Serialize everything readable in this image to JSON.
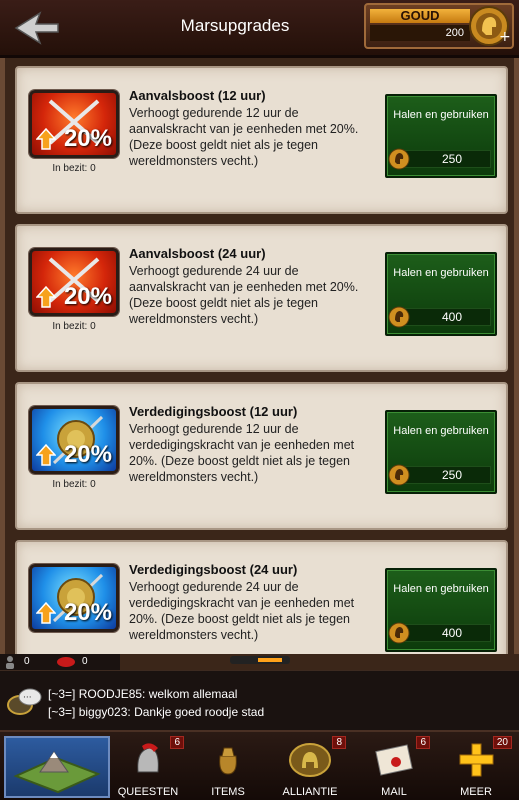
{
  "header": {
    "title": "Marsupgrades",
    "gold_label": "GOUD",
    "gold_value": "200"
  },
  "cards": [
    {
      "title": "Aanvalsboost (12 uur)",
      "desc": "Verhoogt gedurende 12 uur de aanvalskracht van je eenheden met 20%. (Deze boost geldt niet als je tegen wereldmonsters vecht.)",
      "pct": "20%",
      "in_bezit": "In bezit: 0",
      "button": "Halen en gebruiken",
      "price": "250",
      "kind": "attack"
    },
    {
      "title": "Aanvalsboost (24 uur)",
      "desc": "Verhoogt gedurende 24 uur de aanvalskracht van je eenheden met 20%.(Deze boost geldt niet als je tegen wereldmonsters vecht.)",
      "pct": "20%",
      "in_bezit": "In bezit: 0",
      "button": "Halen en gebruiken",
      "price": "400",
      "kind": "attack"
    },
    {
      "title": "Verdedigingsboost (12 uur)",
      "desc": "Verhoogt gedurende 12 uur de verdedigingskracht van je eenheden met 20%. (Deze boost geldt niet als je tegen wereldmonsters vecht.)",
      "pct": "20%",
      "in_bezit": "In bezit: 0",
      "button": "Halen en gebruiken",
      "price": "250",
      "kind": "defense"
    },
    {
      "title": "Verdedigingsboost (24 uur)",
      "desc": "Verhoogt gedurende 24 uur de verdedigingskracht van je eenheden met 20%. (Deze boost geldt niet als je tegen wereldmonsters vecht.)",
      "pct": "20%",
      "in_bezit": "",
      "button": "Halen en gebruiken",
      "price": "400",
      "kind": "defense"
    }
  ],
  "status": {
    "players": "0",
    "messages": "0"
  },
  "chat": {
    "line1": "[~3=] ROODJE85: welkom allemaal",
    "line2": "[~3=] biggy023: Dankje goed roodje stad"
  },
  "nav": {
    "quests_label": "QUEESTEN",
    "quests_badge": "6",
    "items_label": "ITEMS",
    "alliance_label": "ALLIANTIE",
    "alliance_badge": "8",
    "mail_label": "MAIL",
    "mail_badge": "6",
    "more_label": "MEER",
    "more_badge": "20"
  },
  "colors": {
    "button_green": "#1d5e1a",
    "card_bg": "#e8dfd2",
    "accent_orange": "#ffa11a"
  }
}
